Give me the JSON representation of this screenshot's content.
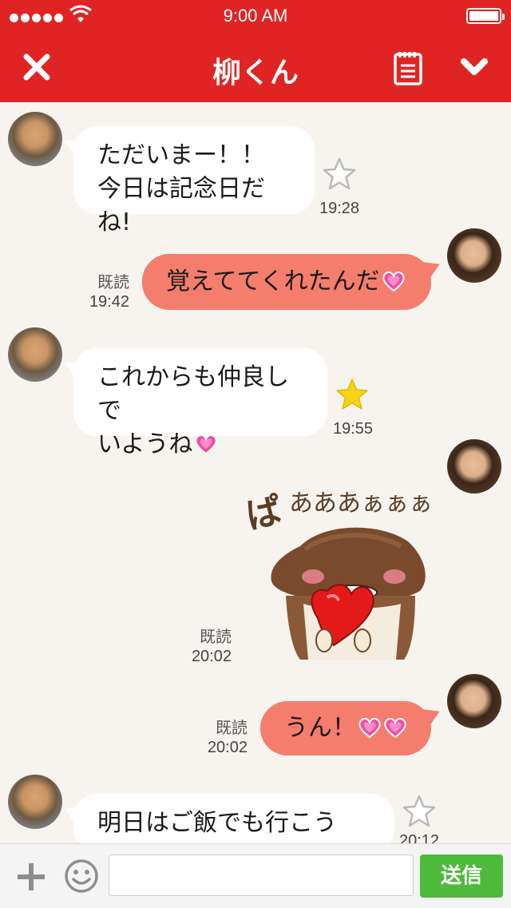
{
  "status_bar": {
    "time": "9:00 AM",
    "signal_dots": 5,
    "battery_level": 1.0
  },
  "nav": {
    "title": "柳くん",
    "close_icon": "close-icon",
    "notes_icon": "notepad-icon",
    "menu_icon": "chevron-down-icon"
  },
  "messages": [
    {
      "side": "in",
      "lines": [
        "ただいまー！！",
        "今日は記念日だね!"
      ],
      "time": "19:28",
      "starred": false
    },
    {
      "side": "out",
      "text": "覚えててくれたんだ",
      "read": "既読",
      "time": "19:42"
    },
    {
      "side": "in",
      "lines": [
        "これからも仲良しで",
        "いようね"
      ],
      "time": "19:55",
      "starred": true
    },
    {
      "side": "out",
      "sticker_text": "ぱあああぁぁぁ",
      "read": "既読",
      "time": "20:02"
    },
    {
      "side": "out",
      "text": "うん！",
      "read": "既読",
      "time": "20:02"
    },
    {
      "side": "in",
      "lines": [
        "明日はご飯でも行こうよ！"
      ],
      "time": "20:12",
      "starred": false
    }
  ],
  "input": {
    "placeholder": "",
    "send_label": "送信"
  },
  "colors": {
    "header": "#e02424",
    "outgoing_bubble": "#f47d6d",
    "incoming_bubble": "#ffffff",
    "background": "#f7f4ef",
    "send_button": "#4fba3c",
    "star_active": "#f7d21a"
  }
}
